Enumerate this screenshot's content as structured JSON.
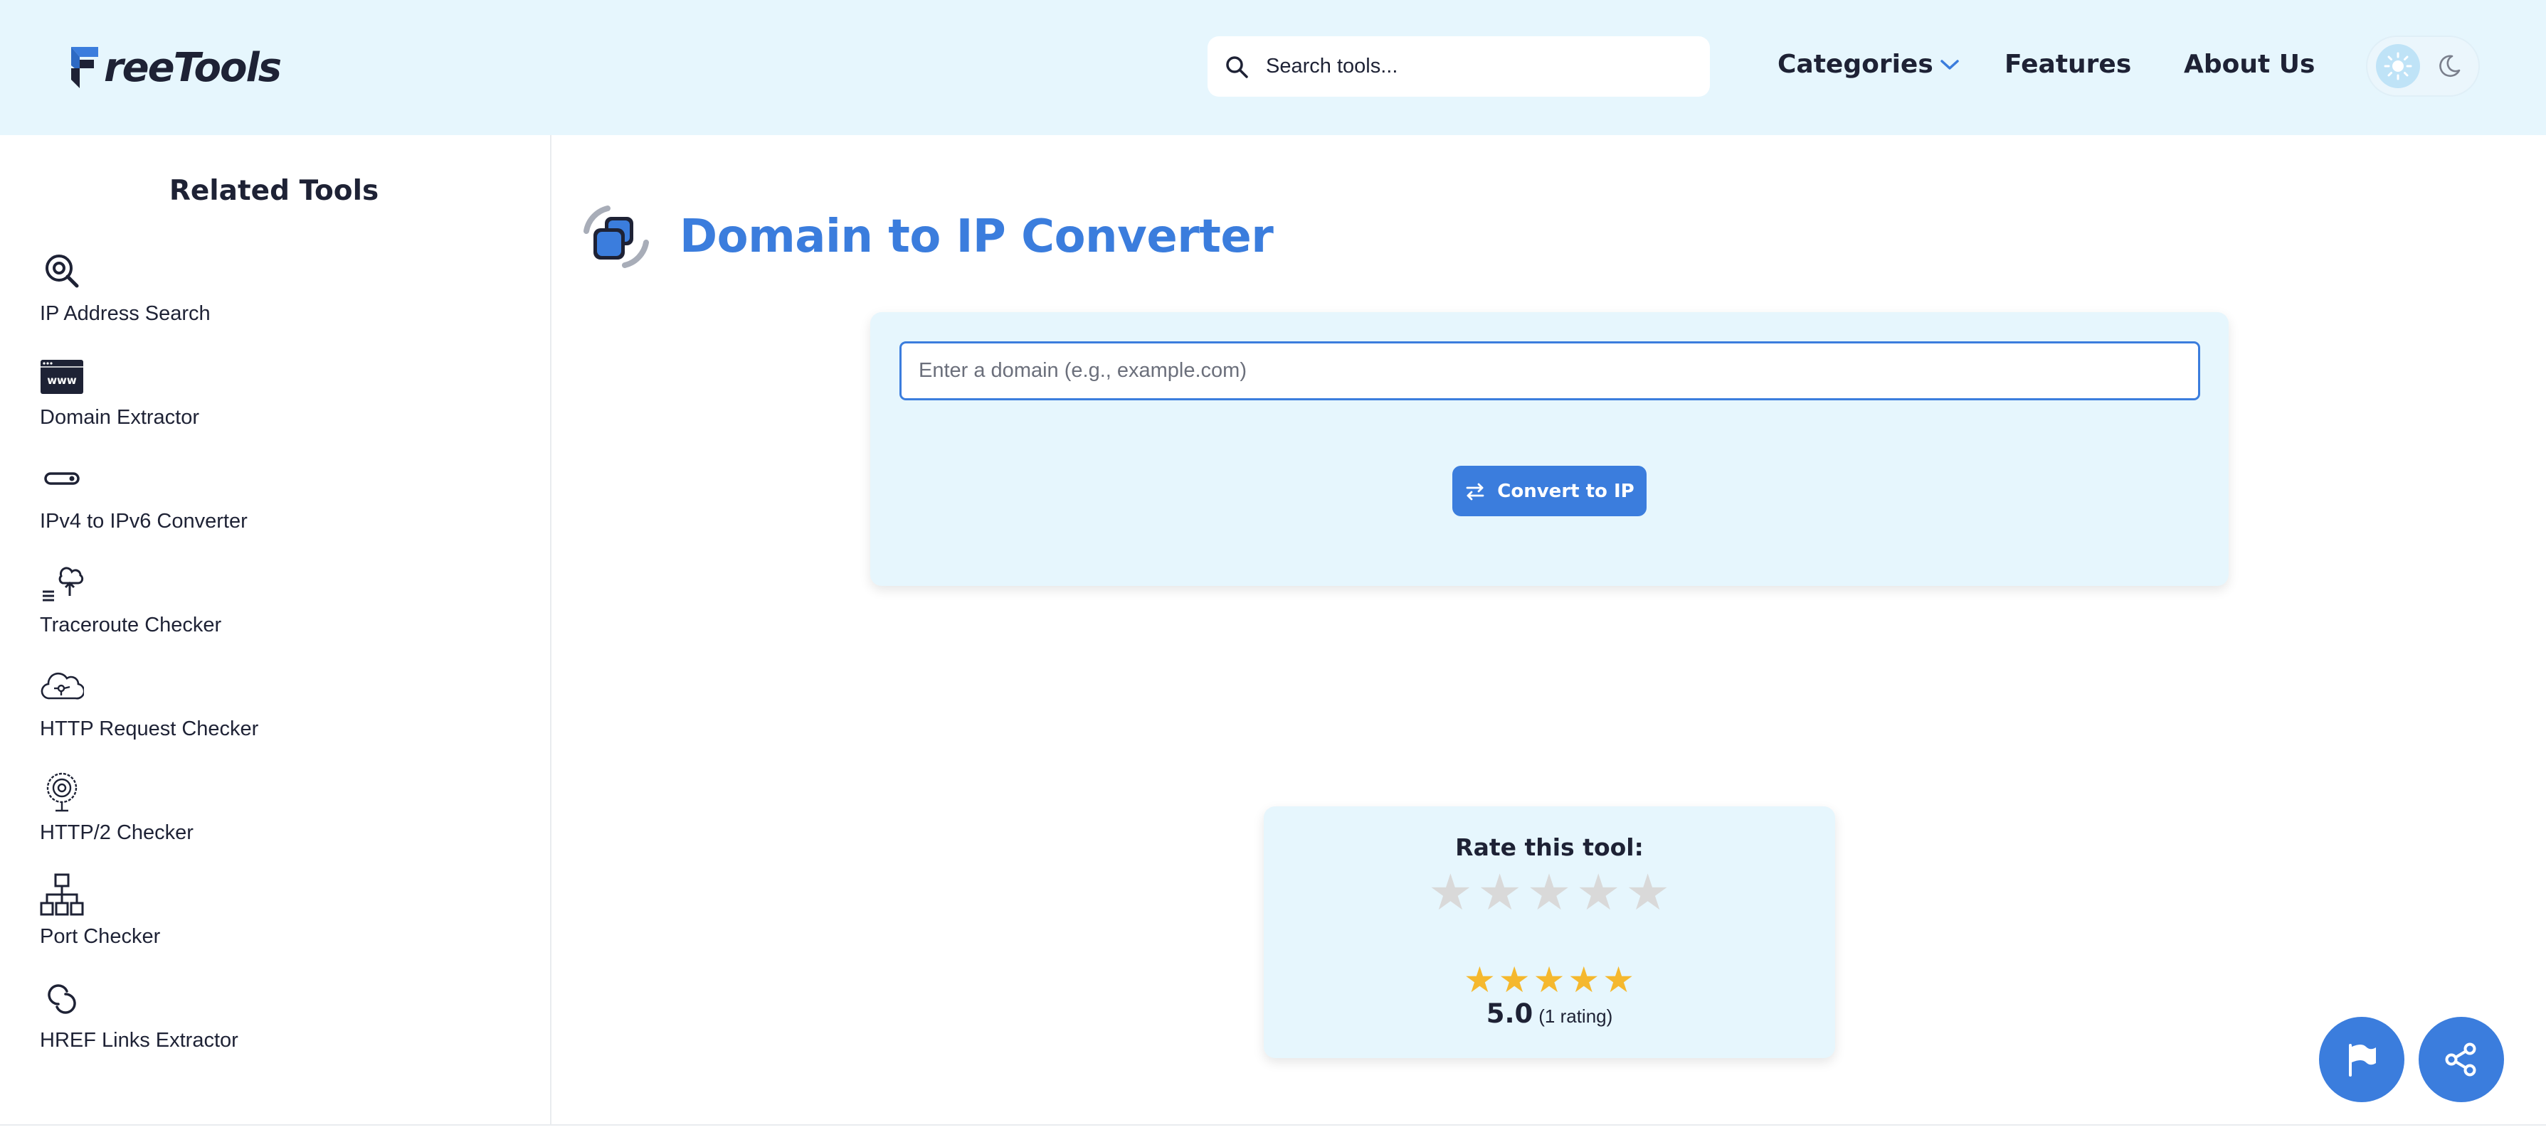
{
  "header": {
    "logo_text": "reeTools",
    "logo_full_name": "FreeTools",
    "search_placeholder": "Search tools...",
    "nav": {
      "categories": "Categories",
      "features": "Features",
      "about": "About Us"
    },
    "theme": {
      "active": "light",
      "options": [
        "light",
        "dark"
      ]
    }
  },
  "sidebar": {
    "title": "Related Tools",
    "items": [
      {
        "label": "IP Address Search",
        "icon": "magnifier-location-icon"
      },
      {
        "label": "Domain Extractor",
        "icon": "www-browser-icon"
      },
      {
        "label": "IPv4 to IPv6 Converter",
        "icon": "toggle-pill-icon"
      },
      {
        "label": "Traceroute Checker",
        "icon": "cloud-upload-list-icon"
      },
      {
        "label": "HTTP Request Checker",
        "icon": "cloud-network-icon"
      },
      {
        "label": "HTTP/2 Checker",
        "icon": "globe-network-icon"
      },
      {
        "label": "Port Checker",
        "icon": "sitemap-icon"
      },
      {
        "label": "HREF Links Extractor",
        "icon": "link-rings-icon"
      }
    ]
  },
  "main": {
    "title": "Domain to IP Converter",
    "input_placeholder": "Enter a domain (e.g., example.com)",
    "input_value": "",
    "convert_label": "Convert to IP"
  },
  "rating": {
    "prompt": "Rate this tool:",
    "user_stars": 0,
    "max_stars": 5,
    "average": "5.0",
    "average_stars": 5,
    "count_text": "(1 rating)"
  },
  "fabs": [
    {
      "icon": "flag-icon"
    },
    {
      "icon": "share-icon"
    }
  ],
  "colors": {
    "accent": "#3b7ddd",
    "header_bg": "#e6f6fd",
    "text": "#1e2235",
    "star_filled": "#f5b82e",
    "star_empty": "#d9d9d9"
  }
}
